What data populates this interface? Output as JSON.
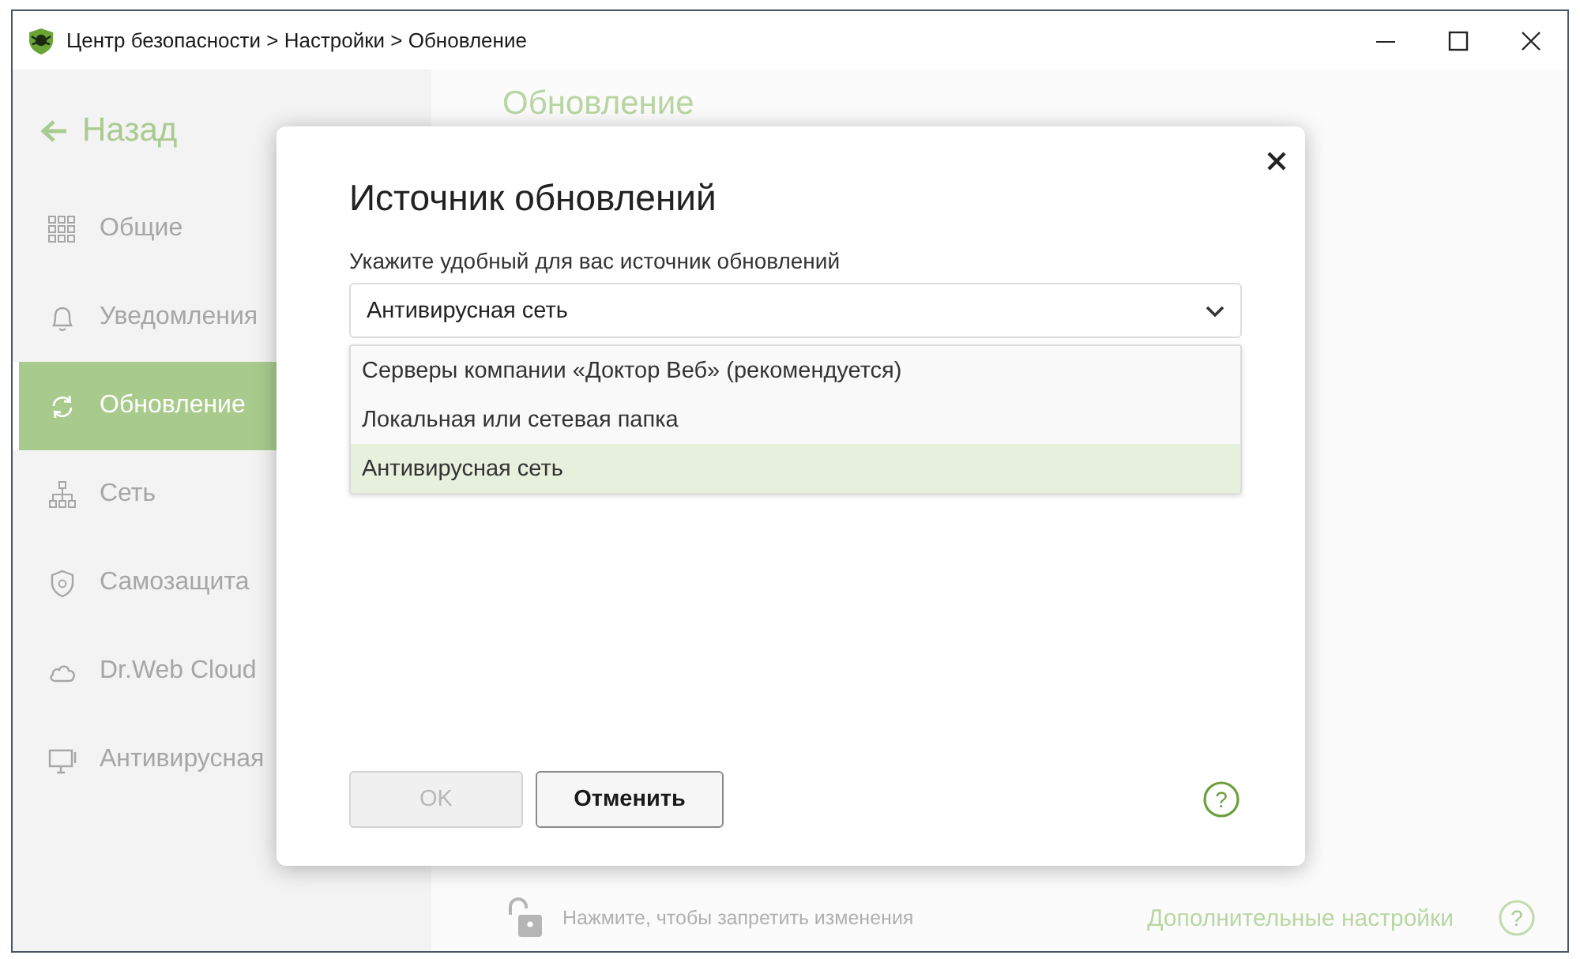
{
  "window": {
    "title": "Центр безопасности > Настройки > Обновление"
  },
  "sidebar": {
    "back": "Назад",
    "items": [
      {
        "label": "Общие",
        "selected": false
      },
      {
        "label": "Уведомления",
        "selected": false
      },
      {
        "label": "Обновление",
        "selected": true
      },
      {
        "label": "Сеть",
        "selected": false
      },
      {
        "label": "Самозащита",
        "selected": false
      },
      {
        "label": "Dr.Web Cloud",
        "selected": false
      },
      {
        "label": "Антивирусная",
        "selected": false
      }
    ]
  },
  "page": {
    "heading": "Обновление",
    "lock_hint": "Нажмите, чтобы запретить изменения",
    "advanced_link": "Дополнительные настройки",
    "help_mark": "?"
  },
  "dialog": {
    "title": "Источник обновлений",
    "label": "Укажите удобный для вас источник обновлений",
    "select": {
      "value": "Антивирусная сеть",
      "expanded": true
    },
    "options": [
      {
        "label": "Серверы компании «Доктор Веб» (рекомендуется)",
        "selected": false
      },
      {
        "label": "Локальная или сетевая папка",
        "selected": false
      },
      {
        "label": "Антивирусная сеть",
        "selected": true
      }
    ],
    "buttons": [
      {
        "label": "OK",
        "disabled": true
      },
      {
        "label": "Отменить",
        "disabled": false
      }
    ],
    "help_mark": "?"
  }
}
